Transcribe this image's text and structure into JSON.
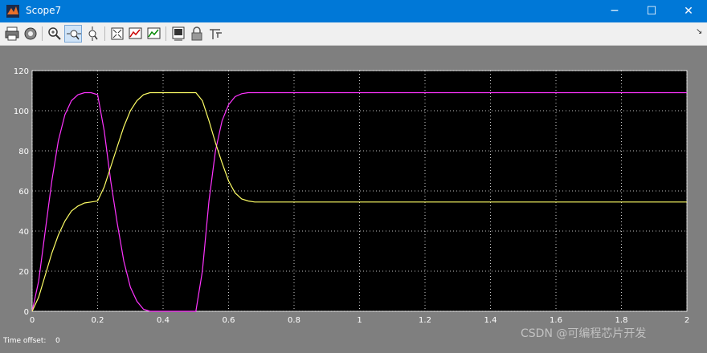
{
  "window": {
    "title": "Scope7",
    "minimize_glyph": "─",
    "maximize_glyph": "☐",
    "close_glyph": "✕"
  },
  "toolbar": {
    "buttons": [
      {
        "name": "print-icon"
      },
      {
        "name": "parameters-icon"
      },
      {
        "name": "zoom-icon"
      },
      {
        "name": "zoom-x-axis-icon",
        "active": true
      },
      {
        "name": "zoom-y-axis-icon"
      },
      {
        "name": "autoscale-icon"
      },
      {
        "name": "save-axes-settings-icon"
      },
      {
        "name": "restore-axes-settings-icon"
      },
      {
        "name": "floating-scope-icon"
      },
      {
        "name": "lock-axes-icon"
      },
      {
        "name": "signal-selection-icon"
      }
    ],
    "overflow_glyph": "↘"
  },
  "status": {
    "time_offset_label": "Time offset:",
    "time_offset_value": "0"
  },
  "watermark": "CSDN @可编程芯片开发",
  "chart_data": {
    "type": "line",
    "xlim": [
      0,
      2
    ],
    "ylim": [
      0,
      120
    ],
    "xticks": [
      "0",
      "0.2",
      "0.4",
      "0.6",
      "0.8",
      "1",
      "1.2",
      "1.4",
      "1.6",
      "1.8",
      "2"
    ],
    "yticks": [
      "0",
      "20",
      "40",
      "60",
      "80",
      "100",
      "120"
    ],
    "grid": true,
    "background": "#000000",
    "series": [
      {
        "color": "#ff33ff",
        "x": [
          0,
          0.02,
          0.04,
          0.06,
          0.08,
          0.1,
          0.12,
          0.14,
          0.16,
          0.18,
          0.2,
          0.22,
          0.24,
          0.26,
          0.28,
          0.3,
          0.32,
          0.34,
          0.36,
          0.38,
          0.4,
          0.42,
          0.44,
          0.46,
          0.48,
          0.5,
          0.52,
          0.54,
          0.56,
          0.58,
          0.6,
          0.62,
          0.64,
          0.66,
          0.68,
          0.7,
          0.8,
          1.0,
          1.2,
          1.4,
          1.6,
          1.8,
          2.0
        ],
        "y": [
          0,
          15,
          40,
          65,
          85,
          98,
          105,
          108,
          109,
          109,
          108,
          90,
          65,
          44,
          25,
          12,
          5,
          1,
          0,
          0,
          0,
          0,
          0,
          0,
          0,
          0,
          20,
          55,
          80,
          95,
          103,
          107,
          108.5,
          109,
          109,
          109,
          109,
          109,
          109,
          109,
          109,
          109,
          109
        ]
      },
      {
        "color": "#ffff66",
        "x": [
          0,
          0.02,
          0.04,
          0.06,
          0.08,
          0.1,
          0.12,
          0.14,
          0.16,
          0.18,
          0.2,
          0.22,
          0.24,
          0.26,
          0.28,
          0.3,
          0.32,
          0.34,
          0.36,
          0.38,
          0.4,
          0.42,
          0.44,
          0.46,
          0.48,
          0.5,
          0.52,
          0.54,
          0.56,
          0.58,
          0.6,
          0.62,
          0.64,
          0.66,
          0.68,
          0.7,
          0.8,
          1.0,
          1.2,
          1.4,
          1.6,
          1.8,
          2.0
        ],
        "y": [
          0,
          7,
          18,
          29,
          38,
          45,
          50,
          52.5,
          54,
          54.5,
          55,
          62,
          72,
          82,
          92,
          100,
          105,
          108,
          109,
          109,
          109,
          109,
          109,
          109,
          109,
          109,
          105,
          95,
          84,
          74,
          65,
          59,
          56,
          55,
          54.5,
          54.5,
          54.5,
          54.5,
          54.5,
          54.5,
          54.5,
          54.5,
          54.5
        ]
      }
    ]
  }
}
